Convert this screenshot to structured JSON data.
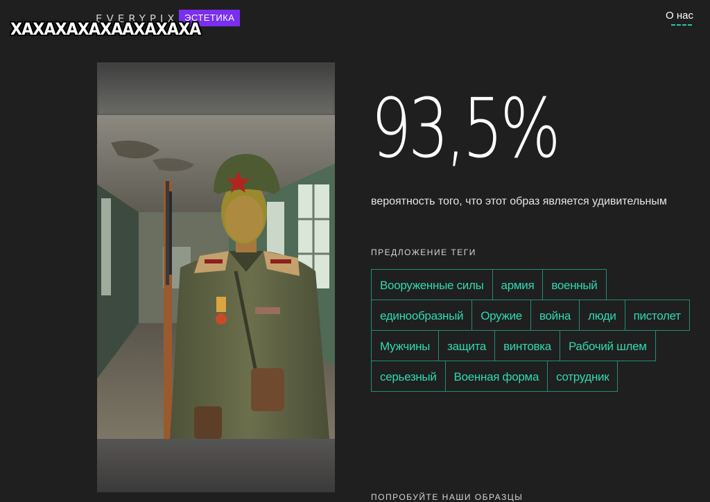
{
  "header": {
    "brand": "EVERYPIXEL",
    "badge": "ЭСТЕТИКА",
    "about": "О нас",
    "meme_caption": "ХАХАХАХАХААХАХАХА"
  },
  "result": {
    "score": "93,5%",
    "subtitle": "вероятность того, что этот образ является удивительным"
  },
  "tags_section": {
    "label": "ПРЕДЛОЖЕНИЕ ТЕГИ",
    "tags": [
      "Вооруженные силы",
      "армия",
      "военный",
      "единообразный",
      "Оружие",
      "война",
      "люди",
      "пистолет",
      "Мужчины",
      "защита",
      "винтовка",
      "Рабочий шлем",
      "серьезный",
      "Военная форма",
      "сотрудник"
    ]
  },
  "try_section": {
    "label": "ПОПРОБУЙТЕ НАШИ ОБРАЗЦЫ"
  },
  "colors": {
    "background": "#1f1f1f",
    "accent": "#2fd9b2",
    "badge": "#7a2ff0"
  }
}
